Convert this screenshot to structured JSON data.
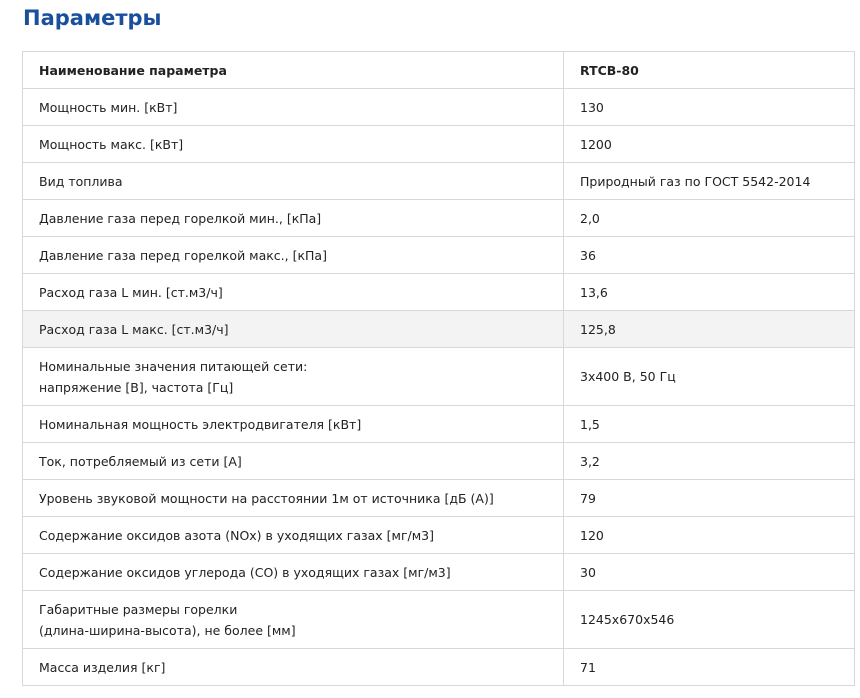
{
  "title": "Параметры",
  "header": {
    "name": "Наименование параметра",
    "value": "RTCB-80"
  },
  "rows": [
    {
      "name": "Мощность мин. [кВт]",
      "value": "130"
    },
    {
      "name": "Мощность макс. [кВт]",
      "value": "1200"
    },
    {
      "name": "Вид топлива",
      "value": "Природный газ по ГОСТ 5542-2014"
    },
    {
      "name": "Давление газа перед горелкой мин., [кПа]",
      "value": "2,0"
    },
    {
      "name": "Давление газа перед горелкой макс., [кПа]",
      "value": "36"
    },
    {
      "name": "Расход газа L мин. [ст.м3/ч]",
      "value": "13,6"
    },
    {
      "name": "Расход газа L макс. [ст.м3/ч]",
      "value": "125,8"
    },
    {
      "name_line1": "Номинальные значения питающей сети:",
      "name_line2": "напряжение [В], частота [Гц]",
      "value": "3x400 В, 50 Гц"
    },
    {
      "name": "Номинальная мощность электродвигателя [кВт]",
      "value": "1,5"
    },
    {
      "name": "Ток, потребляемый из сети [А]",
      "value": "3,2"
    },
    {
      "name": "Уровень звуковой мощности на расстоянии 1м от источника [дБ (А)]",
      "value": "79"
    },
    {
      "name": "Содержание оксидов азота (NOx) в уходящих газах [мг/м3]",
      "value": "120"
    },
    {
      "name": "Содержание оксидов углерода (CO) в уходящих газах [мг/м3]",
      "value": "30"
    },
    {
      "name_line1": "Габаритные размеры горелки",
      "name_line2": "(длина-ширина-высота), не более [мм]",
      "value": "1245x670x546"
    },
    {
      "name": "Масса изделия [кг]",
      "value": "71"
    }
  ]
}
